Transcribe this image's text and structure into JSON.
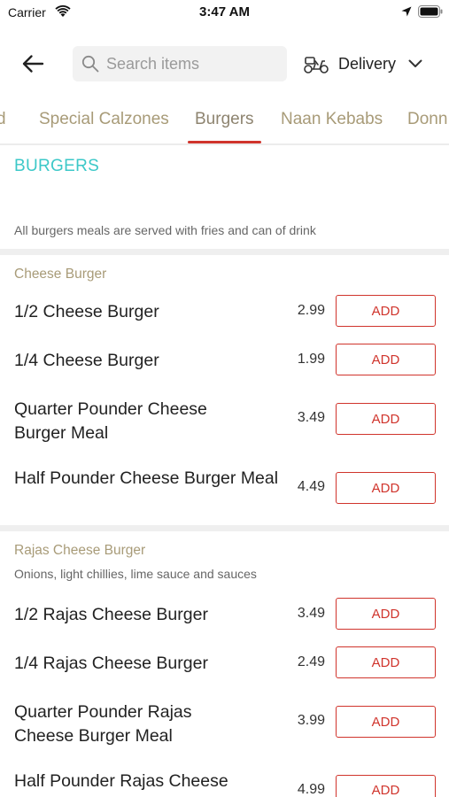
{
  "status_bar": {
    "carrier": "Carrier",
    "time": "3:47 AM"
  },
  "header": {
    "search_placeholder": "Search items",
    "delivery_label": "Delivery"
  },
  "tabs": [
    {
      "label": "d"
    },
    {
      "label": "Special Calzones"
    },
    {
      "label": "Burgers",
      "active": true
    },
    {
      "label": "Naan Kebabs"
    },
    {
      "label": "Donn"
    }
  ],
  "section": {
    "title": "BURGERS",
    "note": "All burgers meals are served with fries and can of drink"
  },
  "groups": [
    {
      "title": "Cheese Burger",
      "items": [
        {
          "name": "1/2 Cheese Burger",
          "price": "2.99",
          "action": "ADD"
        },
        {
          "name": "1/4 Cheese Burger",
          "price": "1.99",
          "action": "ADD"
        },
        {
          "name": "Quarter Pounder Cheese Burger Meal",
          "price": "3.49",
          "action": "ADD"
        },
        {
          "name": "Half Pounder Cheese Burger Meal",
          "price": "4.49",
          "action": "ADD"
        }
      ]
    },
    {
      "title": "Rajas Cheese Burger",
      "description": "Onions, light chillies, lime sauce and sauces",
      "items": [
        {
          "name": "1/2 Rajas Cheese Burger",
          "price": "3.49",
          "action": "ADD"
        },
        {
          "name": "1/4 Rajas Cheese Burger",
          "price": "2.49",
          "action": "ADD"
        },
        {
          "name": "Quarter Pounder Rajas Cheese Burger Meal",
          "price": "3.99",
          "action": "ADD"
        },
        {
          "name": "Half Pounder Rajas Cheese",
          "price": "4.99",
          "action": "ADD"
        }
      ]
    }
  ],
  "colors": {
    "accent": "#d0342c",
    "section_title": "#3cc8c8",
    "tab_text": "#a89b78"
  }
}
